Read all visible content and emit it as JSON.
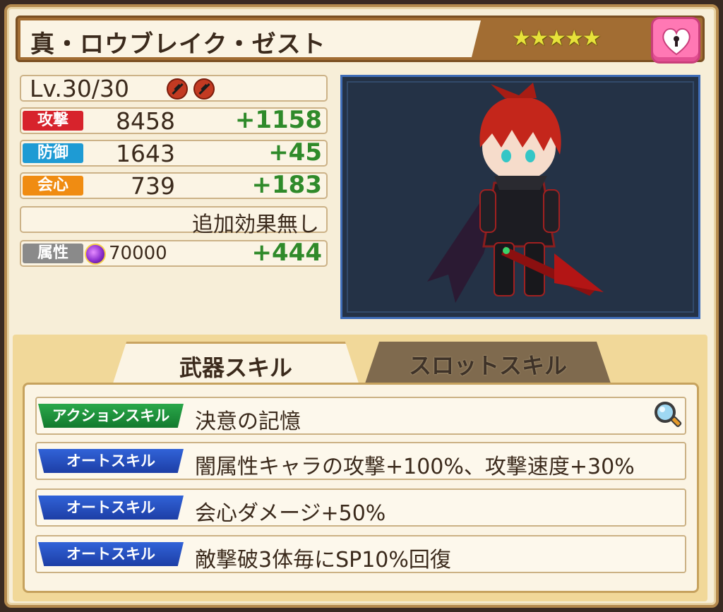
{
  "title": "真・ロウブレイク・ゼスト",
  "rarity": {
    "stars": 5,
    "star_glyph": "★"
  },
  "favorite_icon": "heart-lock-icon",
  "stats": {
    "level": "Lv.30/30",
    "attack": {
      "label": "攻撃",
      "value": "8458",
      "bonus": "+1158"
    },
    "defense": {
      "label": "防御",
      "value": "1643",
      "bonus": "+45"
    },
    "critical": {
      "label": "会心",
      "value": "739",
      "bonus": "+183"
    },
    "extra_effect": "追加効果無し",
    "attribute": {
      "label": "属性",
      "value": "70000",
      "bonus": "+444",
      "element_icon": "dark-orb-icon"
    }
  },
  "tabs": [
    {
      "label": "武器スキル",
      "active": true
    },
    {
      "label": "スロットスキル",
      "active": false
    }
  ],
  "skills": [
    {
      "type": "アクションスキル",
      "text": "決意の記憶"
    },
    {
      "type": "オートスキル",
      "text": "闇属性キャラの攻撃+100%、攻撃速度+30%"
    },
    {
      "type": "オートスキル",
      "text": "会心ダメージ+50%"
    },
    {
      "type": "オートスキル",
      "text": "敵撃破3体毎にSP10%回復"
    }
  ],
  "colors": {
    "attack": "#d7232c",
    "defense": "#1e9bd4",
    "critical": "#f08c12",
    "attribute": "#8a8a8a",
    "bonus": "#2f8a2a",
    "action_tag": "#1f9440",
    "auto_tag": "#2a52c6"
  }
}
